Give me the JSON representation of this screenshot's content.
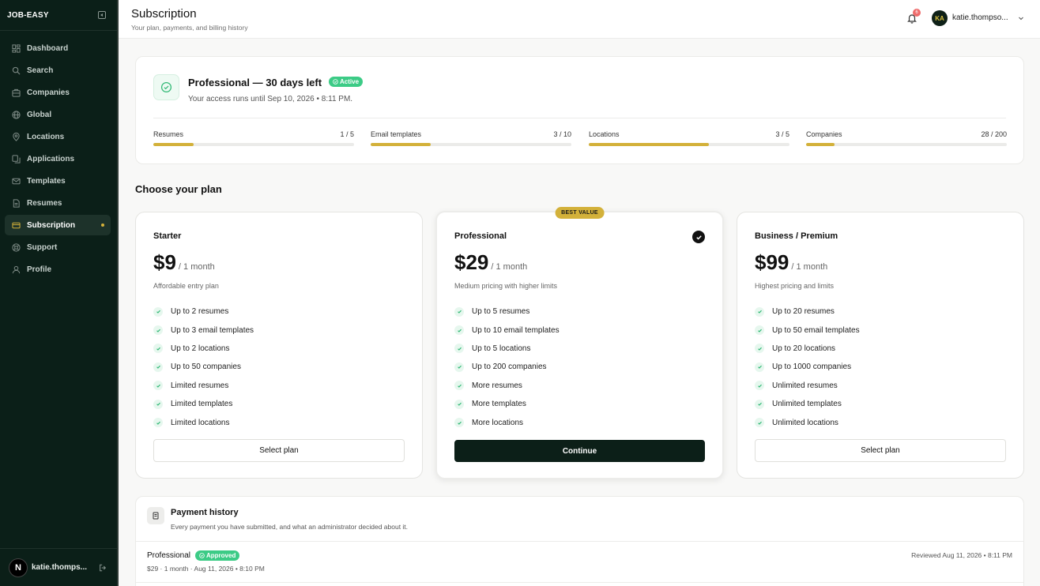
{
  "sidebar": {
    "brand": "JOB-EASY",
    "items": [
      {
        "label": "Dashboard",
        "icon": "dashboard-icon"
      },
      {
        "label": "Search",
        "icon": "search-icon"
      },
      {
        "label": "Companies",
        "icon": "building-icon"
      },
      {
        "label": "Global",
        "icon": "globe-icon"
      },
      {
        "label": "Locations",
        "icon": "map-pin-icon"
      },
      {
        "label": "Applications",
        "icon": "applications-icon"
      },
      {
        "label": "Templates",
        "icon": "mail-icon"
      },
      {
        "label": "Resumes",
        "icon": "document-icon"
      },
      {
        "label": "Subscription",
        "icon": "credit-card-icon",
        "active": true
      },
      {
        "label": "Support",
        "icon": "lifebuoy-icon"
      },
      {
        "label": "Profile",
        "icon": "user-icon"
      }
    ],
    "user": {
      "initial": "N",
      "name": "katie.thomps..."
    }
  },
  "header": {
    "title": "Subscription",
    "subtitle": "Your plan, payments, and billing history",
    "notification_count": "6",
    "user_initials": "KA",
    "user_name": "katie.thompso..."
  },
  "current_plan": {
    "title": "Professional — 30 days left",
    "status": "Active",
    "access_text": "Your access runs until Sep 10, 2026 • 8:11 PM.",
    "usage": [
      {
        "label": "Resumes",
        "value": "1 / 5",
        "fraction": 0.2
      },
      {
        "label": "Email templates",
        "value": "3 / 10",
        "fraction": 0.3
      },
      {
        "label": "Locations",
        "value": "3 / 5",
        "fraction": 0.6
      },
      {
        "label": "Companies",
        "value": "28 / 200",
        "fraction": 0.14
      }
    ]
  },
  "plans_section": {
    "title": "Choose your plan",
    "plans": [
      {
        "name": "Starter",
        "price": "$9",
        "period": "/ 1 month",
        "description": "Affordable entry plan",
        "features": [
          "Up to 2 resumes",
          "Up to 3 email templates",
          "Up to 2 locations",
          "Up to 50 companies",
          "Limited resumes",
          "Limited templates",
          "Limited locations"
        ],
        "button": "Select plan"
      },
      {
        "name": "Professional",
        "price": "$29",
        "period": "/ 1 month",
        "description": "Medium pricing with higher limits",
        "badge": "BEST VALUE",
        "features": [
          "Up to 5 resumes",
          "Up to 10 email templates",
          "Up to 5 locations",
          "Up to 200 companies",
          "More resumes",
          "More templates",
          "More locations"
        ],
        "button": "Continue"
      },
      {
        "name": "Business / Premium",
        "price": "$99",
        "period": "/ 1 month",
        "description": "Highest pricing and limits",
        "features": [
          "Up to 20 resumes",
          "Up to 50 email templates",
          "Up to 20 locations",
          "Up to 1000 companies",
          "Unlimited resumes",
          "Unlimited templates",
          "Unlimited locations"
        ],
        "button": "Select plan"
      }
    ]
  },
  "payment_history": {
    "title": "Payment history",
    "subtitle": "Every payment you have submitted, and what an administrator decided about it.",
    "rows": [
      {
        "plan": "Professional",
        "status": "Approved",
        "meta": "$29 · 1 month · Aug 11, 2026 • 8:10 PM",
        "reviewed": "Reviewed Aug 11, 2026 • 8:11 PM"
      }
    ]
  },
  "colors": {
    "accent": "#d3b13a",
    "success": "#3ccb86",
    "sidebar": "#0b1f18"
  }
}
